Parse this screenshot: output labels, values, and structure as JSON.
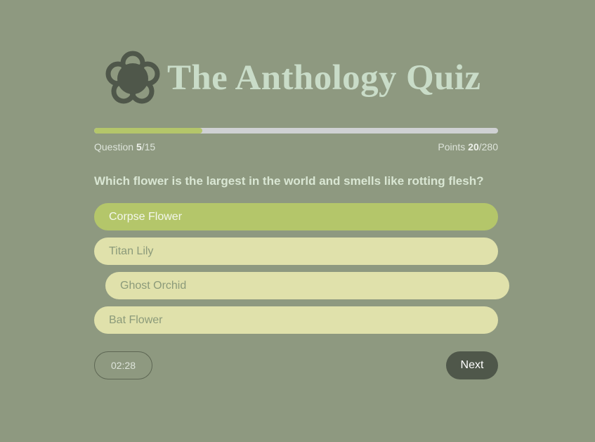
{
  "app": {
    "title": "The Anthology Quiz",
    "logo_icon": "flower-icon"
  },
  "progress": {
    "question_label": "Question",
    "current_question": "5",
    "total_questions": "/15",
    "points_label": "Points",
    "current_points": "20",
    "total_points": "/280",
    "fraction_complete": 0.267
  },
  "question": {
    "text": "Which flower is the largest in the world and smells like rotting flesh?"
  },
  "answers": [
    {
      "label": "Corpse Flower",
      "selected": true
    },
    {
      "label": "Titan Lily",
      "selected": false
    },
    {
      "label": "Ghost Orchid",
      "selected": false
    },
    {
      "label": "Bat Flower",
      "selected": false
    }
  ],
  "footer": {
    "timer": "02:28",
    "next_label": "Next"
  },
  "colors": {
    "background": "#8e9980",
    "accent": "#b4c66a",
    "answer_bg": "#e0e1ab",
    "title": "#c9dcc8",
    "dark": "#4f574a"
  }
}
